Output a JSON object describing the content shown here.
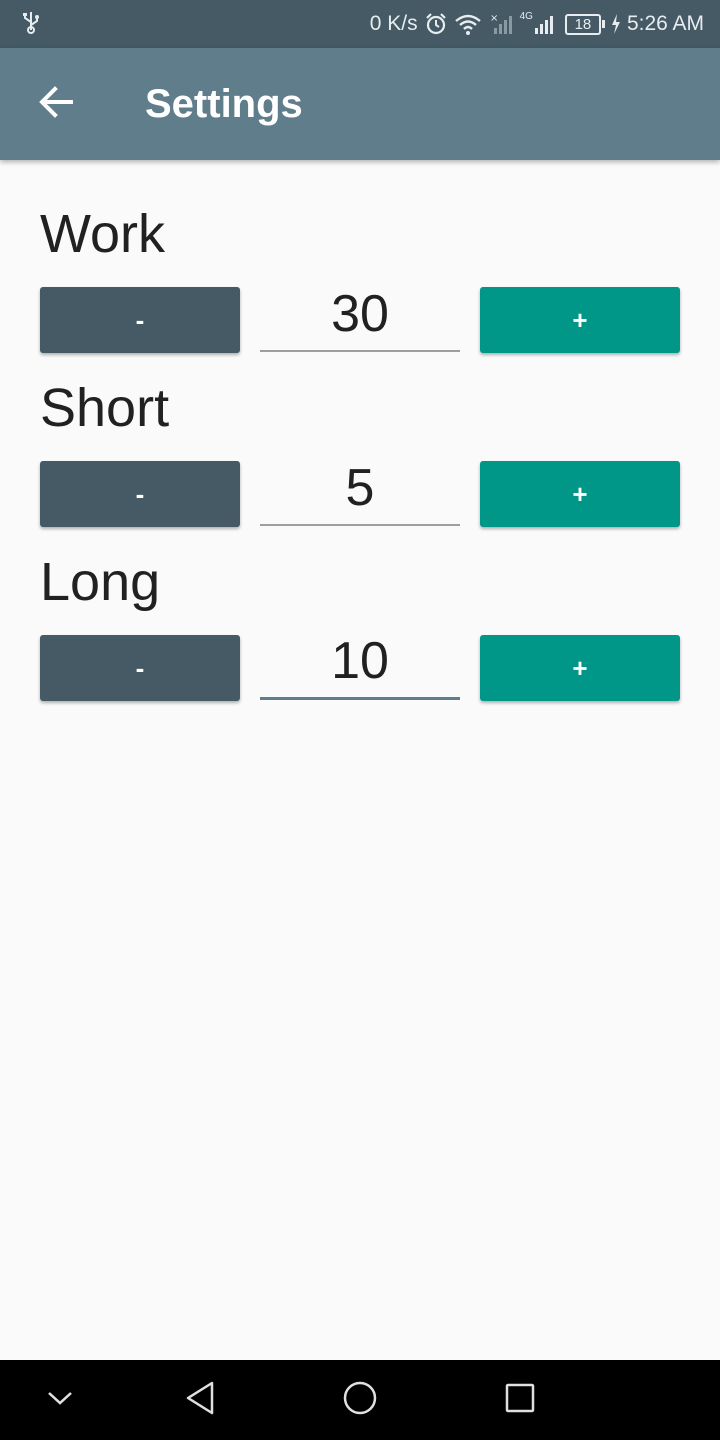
{
  "status_bar": {
    "net_speed": "0 K/s",
    "network_type": "4G",
    "battery": "18",
    "time": "5:26 AM",
    "icons": [
      "usb-icon",
      "alarm-icon",
      "wifi-icon",
      "signal-x-icon",
      "signal-4g-icon",
      "battery-icon",
      "charging-icon"
    ]
  },
  "app_bar": {
    "title": "Settings",
    "back_icon": "arrow-back-icon",
    "background": "#607d8b"
  },
  "settings": [
    {
      "label": "Work",
      "minus_label": "-",
      "value": "30",
      "plus_label": "+"
    },
    {
      "label": "Short",
      "minus_label": "-",
      "value": "5",
      "plus_label": "+"
    },
    {
      "label": "Long",
      "minus_label": "-",
      "value": "10",
      "plus_label": "+"
    }
  ],
  "colors": {
    "minus_button": "#455a64",
    "plus_button": "#009688",
    "status_bar": "#455a64"
  },
  "nav_bar": {
    "icons": [
      "chevron-down-icon",
      "back-triangle-icon",
      "home-circle-icon",
      "recents-square-icon"
    ]
  }
}
